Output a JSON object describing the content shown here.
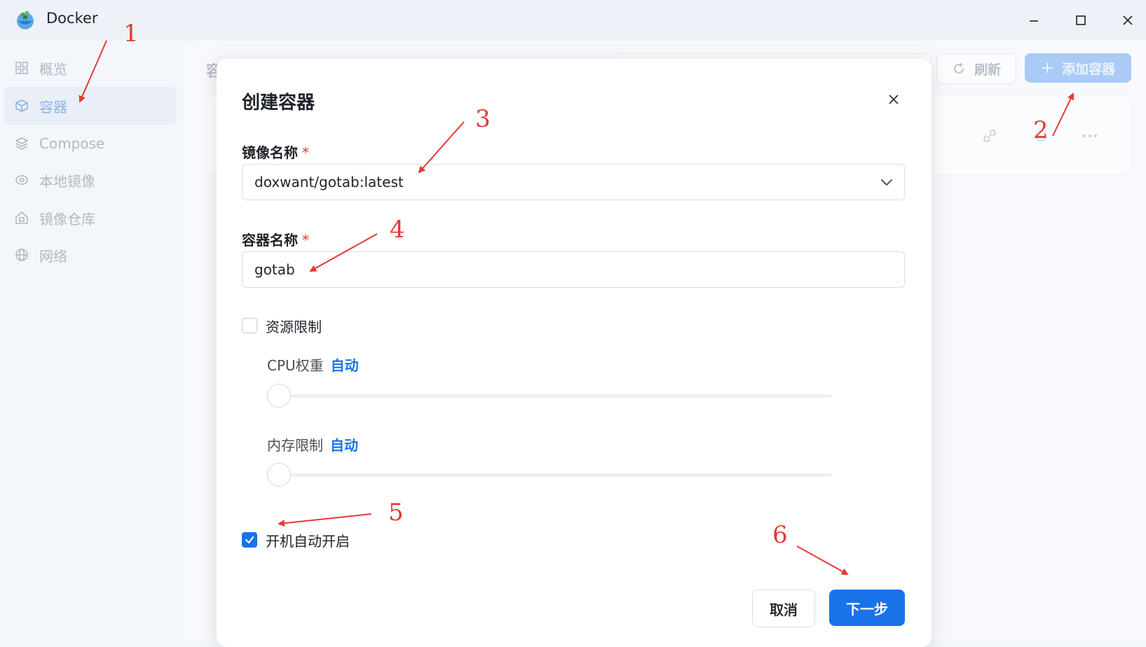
{
  "window": {
    "title": "Docker",
    "logo_icon": "docker-whale-icon"
  },
  "sidebar": {
    "items": [
      {
        "label": "概览",
        "icon": "grid-icon",
        "active": false
      },
      {
        "label": "容器",
        "icon": "cube-icon",
        "active": true
      },
      {
        "label": "Compose",
        "icon": "layers-icon",
        "active": false
      },
      {
        "label": "本地镜像",
        "icon": "disk-icon",
        "active": false
      },
      {
        "label": "镜像仓库",
        "icon": "home-icon",
        "active": false
      },
      {
        "label": "网络",
        "icon": "globe-icon",
        "active": false
      }
    ]
  },
  "main": {
    "page_title": "容",
    "refresh_label": "刷新",
    "add_label": "添加容器"
  },
  "modal": {
    "title": "创建容器",
    "image_name_label": "镜像名称",
    "image_name_value": "doxwant/gotab:latest",
    "container_name_label": "容器名称",
    "container_name_value": "gotab",
    "required_mark": "*",
    "resource_limit_label": "资源限制",
    "resource_limit_checked": false,
    "cpu_label": "CPU权重",
    "cpu_value": "自动",
    "cpu_slider_fraction": 0,
    "memory_label": "内存限制",
    "memory_value": "自动",
    "memory_slider_fraction": 0,
    "autostart_label": "开机自动开启",
    "autostart_checked": true,
    "cancel_label": "取消",
    "next_label": "下一步"
  },
  "annotations": [
    "1",
    "2",
    "3",
    "4",
    "5",
    "6"
  ],
  "colors": {
    "accent": "#1a73e8",
    "annotation": "#e53935",
    "add_button_disabled": "#a9cbf5"
  }
}
